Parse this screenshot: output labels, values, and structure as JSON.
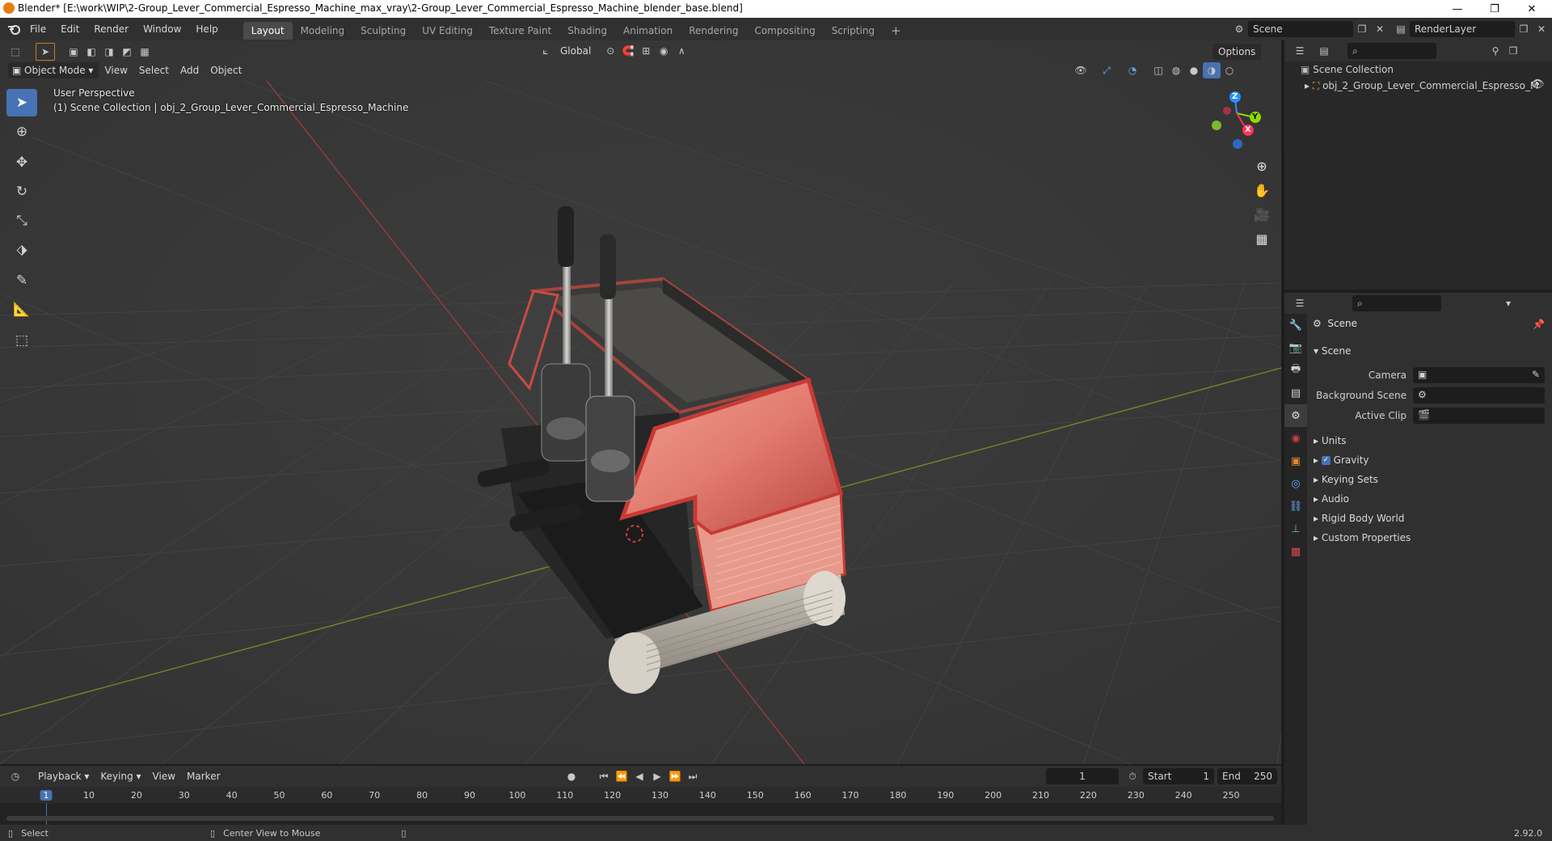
{
  "window": {
    "title": "Blender* [E:\\work\\WIP\\2-Group_Lever_Commercial_Espresso_Machine_max_vray\\2-Group_Lever_Commercial_Espresso_Machine_blender_base.blend]",
    "minimize": "—",
    "maximize": "❐",
    "close": "✕"
  },
  "menu": {
    "items": [
      "File",
      "Edit",
      "Render",
      "Window",
      "Help"
    ]
  },
  "workspaces": {
    "tabs": [
      "Layout",
      "Modeling",
      "Sculpting",
      "UV Editing",
      "Texture Paint",
      "Shading",
      "Animation",
      "Rendering",
      "Compositing",
      "Scripting"
    ],
    "add": "+"
  },
  "scene_selector": {
    "value": "Scene"
  },
  "layer_selector": {
    "value": "RenderLayer"
  },
  "viewport": {
    "mode": "Object Mode",
    "menus": [
      "View",
      "Select",
      "Add",
      "Object"
    ],
    "transform_orientation": "Global",
    "options": "Options",
    "overlay_line1": "User Perspective",
    "overlay_line2": "(1) Scene Collection | obj_2_Group_Lever_Commercial_Espresso_Machine",
    "gizmo": {
      "z": "Z",
      "y": "Y",
      "x": "X"
    }
  },
  "outliner": {
    "root": "Scene Collection",
    "child": "obj_2_Group_Lever_Commercial_Espresso_M"
  },
  "properties": {
    "context_title": "Scene",
    "panel_scene": "Scene",
    "camera_label": "Camera",
    "background_scene_label": "Background Scene",
    "active_clip_label": "Active Clip",
    "panels": [
      "Units",
      "Gravity",
      "Keying Sets",
      "Audio",
      "Rigid Body World",
      "Custom Properties"
    ],
    "gravity_checked": true
  },
  "timeline": {
    "menus": [
      "Playback",
      "Keying",
      "View",
      "Marker"
    ],
    "current_frame": "1",
    "start_label": "Start",
    "start_value": "1",
    "end_label": "End",
    "end_value": "250",
    "ruler": [
      "1",
      "10",
      "20",
      "30",
      "40",
      "50",
      "60",
      "70",
      "80",
      "90",
      "100",
      "110",
      "120",
      "130",
      "140",
      "150",
      "160",
      "170",
      "180",
      "190",
      "200",
      "210",
      "220",
      "230",
      "240",
      "250"
    ]
  },
  "statusbar": {
    "select": "Select",
    "center_view": "Center View to Mouse",
    "version": "2.92.0"
  },
  "colors": {
    "accent": "#4772b3",
    "x_axis": "#ff3352",
    "y_axis": "#8bdc00",
    "z_axis": "#2890ff"
  }
}
